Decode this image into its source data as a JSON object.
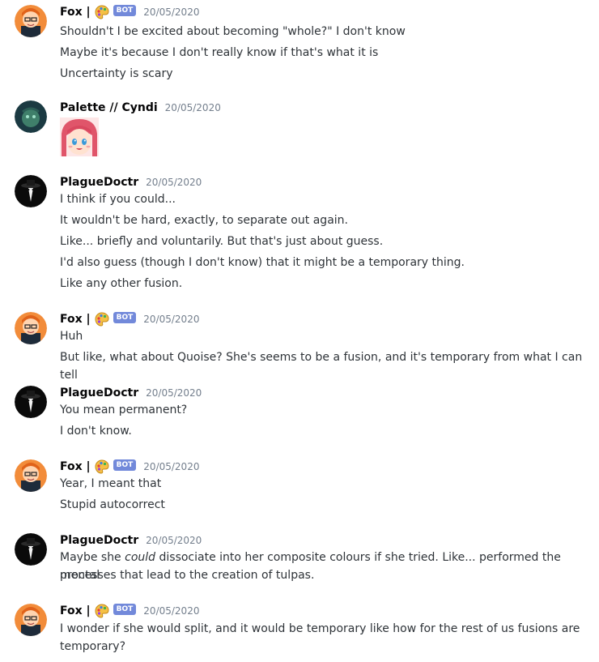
{
  "messages": [
    {
      "author": "Fox |",
      "bot_badge": "BOT",
      "timestamp": "20/05/2020",
      "avatar_icon": "fox-avatar-icon",
      "lines": [
        "Shouldn't I be excited about becoming \"whole?\" I don't know",
        "Maybe it's because I don't really know if that's what it is",
        "Uncertainty is scary"
      ]
    },
    {
      "author": "Palette // Cyndi",
      "timestamp": "20/05/2020",
      "avatar_icon": "palette-avatar-icon",
      "attachment": "anime-girl-emote-image"
    },
    {
      "author": "PlagueDoctr",
      "timestamp": "20/05/2020",
      "avatar_icon": "plague-doctor-avatar-icon",
      "lines": [
        "I think if you could...",
        "It wouldn't be hard, exactly, to separate out again.",
        "Like... briefly and voluntarily. But that's just about guess.",
        "I'd also guess (though I don't know) that it might be a temporary thing.",
        "Like any other fusion."
      ]
    },
    {
      "author": "Fox |",
      "bot_badge": "BOT",
      "timestamp": "20/05/2020",
      "lines": [
        "Huh",
        "But like, what about Quoise? She's seems to be a fusion, and it's temporary from what I can tell"
      ]
    },
    {
      "author": "PlagueDoctr",
      "timestamp": "20/05/2020",
      "lines": [
        "You mean permanent?",
        "I don't know."
      ]
    },
    {
      "author": "Fox |",
      "bot_badge": "BOT",
      "timestamp": "20/05/2020",
      "lines": [
        "Year, I meant that",
        "Stupid autocorrect"
      ]
    },
    {
      "author": "PlagueDoctr",
      "timestamp": "20/05/2020",
      "lines": [
        "Maybe she ",
        "could",
        " dissociate into her composite colours if she tried. Like... performed the mental",
        "processes that lead to the creation of tulpas."
      ]
    },
    {
      "author": "Fox |",
      "bot_badge": "BOT",
      "timestamp": "20/05/2020",
      "lines": [
        "I wonder if she would split, and it would be temporary like how for the rest of us fusions are",
        "temporary?"
      ]
    }
  ],
  "colors": {
    "username": "#060607",
    "text": "#2e3338",
    "timestamp": "#747f8d",
    "bot_badge_bg": "#7289da",
    "background": "#ffffff"
  }
}
